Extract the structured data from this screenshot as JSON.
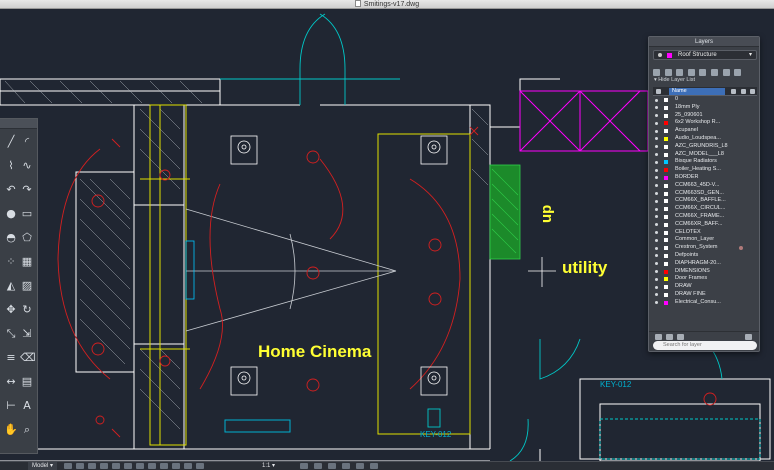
{
  "window": {
    "title": "Smitings-v17.dwg"
  },
  "drawing": {
    "labels": {
      "home_cinema": "Home Cinema",
      "utility": "utility",
      "up": "up",
      "key_012_a": "KEY-012",
      "key_012_b": "KEY-012"
    },
    "colors": {
      "background": "#202632",
      "walls": "#ffffff",
      "joinery": "#ffff00",
      "electrical": "#e02020",
      "doors": "#00c8c8",
      "roof_structure": "#ff00ff",
      "stair": "#1a9a2a",
      "text": "#ffff33"
    }
  },
  "tool_palette": {
    "tools": [
      "line-icon",
      "arc-icon",
      "polyline-icon",
      "spline-icon",
      "undo-icon",
      "redo-icon",
      "circle-icon",
      "rectangle-icon",
      "ellipse-icon",
      "polygon-icon",
      "array-icon",
      "grid-icon",
      "mirror-icon",
      "hatch-icon",
      "move-icon",
      "rotate-icon",
      "scale-icon",
      "stretch-icon",
      "offset-icon",
      "erase-icon",
      "dimension-icon",
      "table-icon",
      "measure-icon",
      "text-icon",
      "pan-icon",
      "zoom-icon"
    ]
  },
  "layers_panel": {
    "title": "Layers",
    "current_layer": "Roof Structure",
    "hide_layer_list": "Hide Layer List",
    "column_name": "Name",
    "search_placeholder": "Search for layer",
    "layers": [
      {
        "name": "0",
        "color": "#ffffff"
      },
      {
        "name": "18mm Ply",
        "color": "#ffffff"
      },
      {
        "name": "25_090601",
        "color": "#ffffff"
      },
      {
        "name": "6x2 Workshop R...",
        "color": "#ff0000"
      },
      {
        "name": "Acupanel",
        "color": "#ffffff"
      },
      {
        "name": "Audio_Loudspea...",
        "color": "#ffff00"
      },
      {
        "name": "AZC_GRUNDRIS_L8",
        "color": "#ffffff"
      },
      {
        "name": "AZC_MODEL___L8",
        "color": "#ffffff"
      },
      {
        "name": "Bisque Radiators",
        "color": "#00c8ff"
      },
      {
        "name": "Boiler_Heating S...",
        "color": "#ff0000"
      },
      {
        "name": "BORDER",
        "color": "#ff00ff"
      },
      {
        "name": "CCM663_45D-V...",
        "color": "#ffffff"
      },
      {
        "name": "CCM663SD_GEN...",
        "color": "#ffffff"
      },
      {
        "name": "CCM66X_BAFFLE...",
        "color": "#ffffff"
      },
      {
        "name": "CCM66X_CIRCUL...",
        "color": "#ffffff"
      },
      {
        "name": "CCM66X_FRAME...",
        "color": "#ffffff"
      },
      {
        "name": "CCM66XR_BAFF...",
        "color": "#ffffff"
      },
      {
        "name": "CELOTEX",
        "color": "#ffffff"
      },
      {
        "name": "Common_Layer",
        "color": "#ffffff"
      },
      {
        "name": "Crestron_System",
        "color": "#ffffff"
      },
      {
        "name": "Defpoints",
        "color": "#ffffff"
      },
      {
        "name": "DIAPHRAGM-20...",
        "color": "#ffffff"
      },
      {
        "name": "DIMENSIONS",
        "color": "#ff0000"
      },
      {
        "name": "Door Frames",
        "color": "#ffff00"
      },
      {
        "name": "DRAW",
        "color": "#ffffff"
      },
      {
        "name": "DRAW FINE",
        "color": "#ffffff"
      },
      {
        "name": "Electrical_Consu...",
        "color": "#ff00ff"
      }
    ]
  },
  "status_bar": {
    "model_tab": "Model",
    "scale": "1:1"
  }
}
